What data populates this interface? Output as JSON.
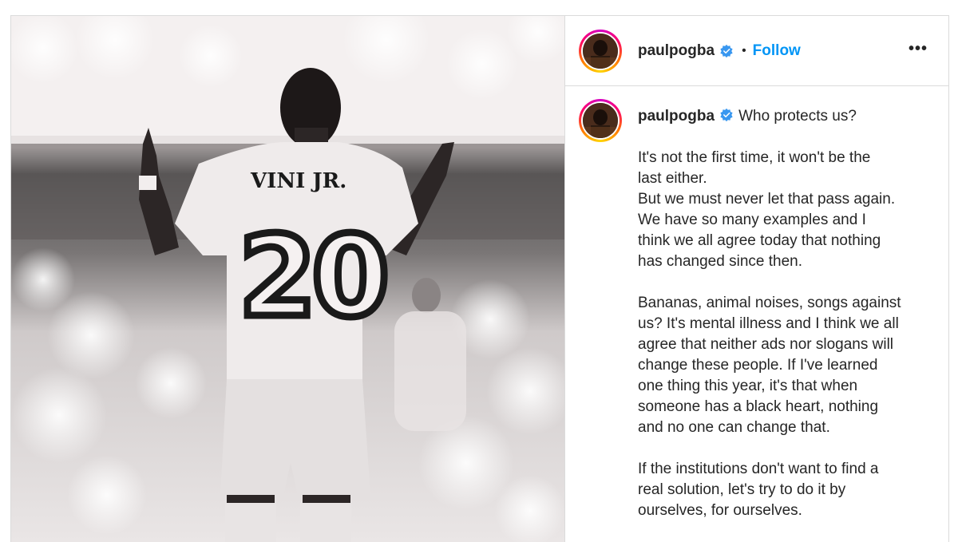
{
  "post": {
    "image_alt_number": "20",
    "image_alt_name": "VINI JR."
  },
  "header": {
    "username": "paulpogba",
    "separator": "•",
    "follow_label": "Follow",
    "more_label": "•••"
  },
  "caption": {
    "username": "paulpogba",
    "first_line": "Who protects us?",
    "paragraphs": [
      [
        "It's not the first time, it won't be the",
        "last either.",
        "But we must never let that pass again.",
        "We have so many examples and I",
        "think we all agree today that nothing",
        "has changed since then."
      ],
      [
        "Bananas, animal noises, songs against",
        "us? It's mental illness and I think we all",
        "agree that neither ads nor slogans will",
        "change these people. If I've learned",
        "one thing this year, it's that when",
        "someone has a black heart, nothing",
        "and no one can change that."
      ],
      [
        "If the institutions don't want to find a",
        "real solution, let's try to do it by",
        "ourselves, for ourselves."
      ]
    ]
  },
  "colors": {
    "follow": "#0095f6",
    "verified": "#3897f0",
    "border": "#dbdbdb"
  },
  "icons": {
    "verified": "verified-badge-icon",
    "more": "more-options-icon"
  }
}
